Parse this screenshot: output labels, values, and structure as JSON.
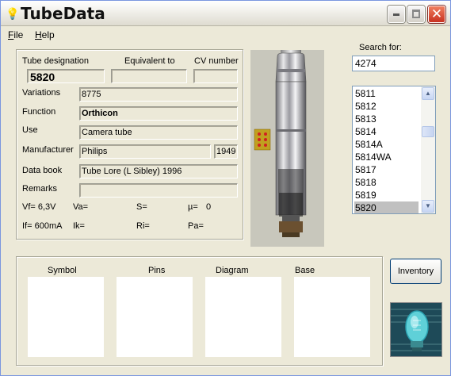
{
  "window": {
    "title": "TubeData"
  },
  "menu": [
    {
      "label": "File",
      "accel": "F",
      "rest": "ile"
    },
    {
      "label": "Help",
      "accel": "H",
      "rest": "elp"
    }
  ],
  "details": {
    "designation_label": "Tube designation",
    "designation": "5820",
    "equivalent_label": "Equivalent to",
    "equivalent": "",
    "cv_label": "CV number",
    "cv": "",
    "variations_label": "Variations",
    "variations": "8775",
    "function_label": "Function",
    "function": "Orthicon",
    "use_label": "Use",
    "use": "Camera tube",
    "manufacturer_label": "Manufacturer",
    "manufacturer": "Philips",
    "year": "1949",
    "databook_label": "Data book",
    "databook": "Tube Lore (L Sibley) 1996",
    "remarks_label": "Remarks",
    "remarks": ""
  },
  "params": {
    "vf": "Vf= 6,3V",
    "va": "Va=",
    "s": "S=",
    "mu": "µ=",
    "mu_val": "0",
    "if": "If= 600mA",
    "ik": "Ik=",
    "ri": "Ri=",
    "pa": "Pa="
  },
  "search": {
    "label": "Search for:",
    "value": "4274"
  },
  "tube_list": [
    "5811",
    "5812",
    "5813",
    "5814",
    "5814A",
    "5814WA",
    "5817",
    "5818",
    "5819",
    "5820"
  ],
  "selected_tube": "5820",
  "panels": {
    "symbol": "Symbol",
    "pins": "Pins",
    "diagram": "Diagram",
    "base": "Base"
  },
  "inventory_label": "Inventory",
  "colors": {
    "window_bg": "#ece9d8",
    "selection": "#c0c0c0",
    "close_button": "#d4502f"
  }
}
